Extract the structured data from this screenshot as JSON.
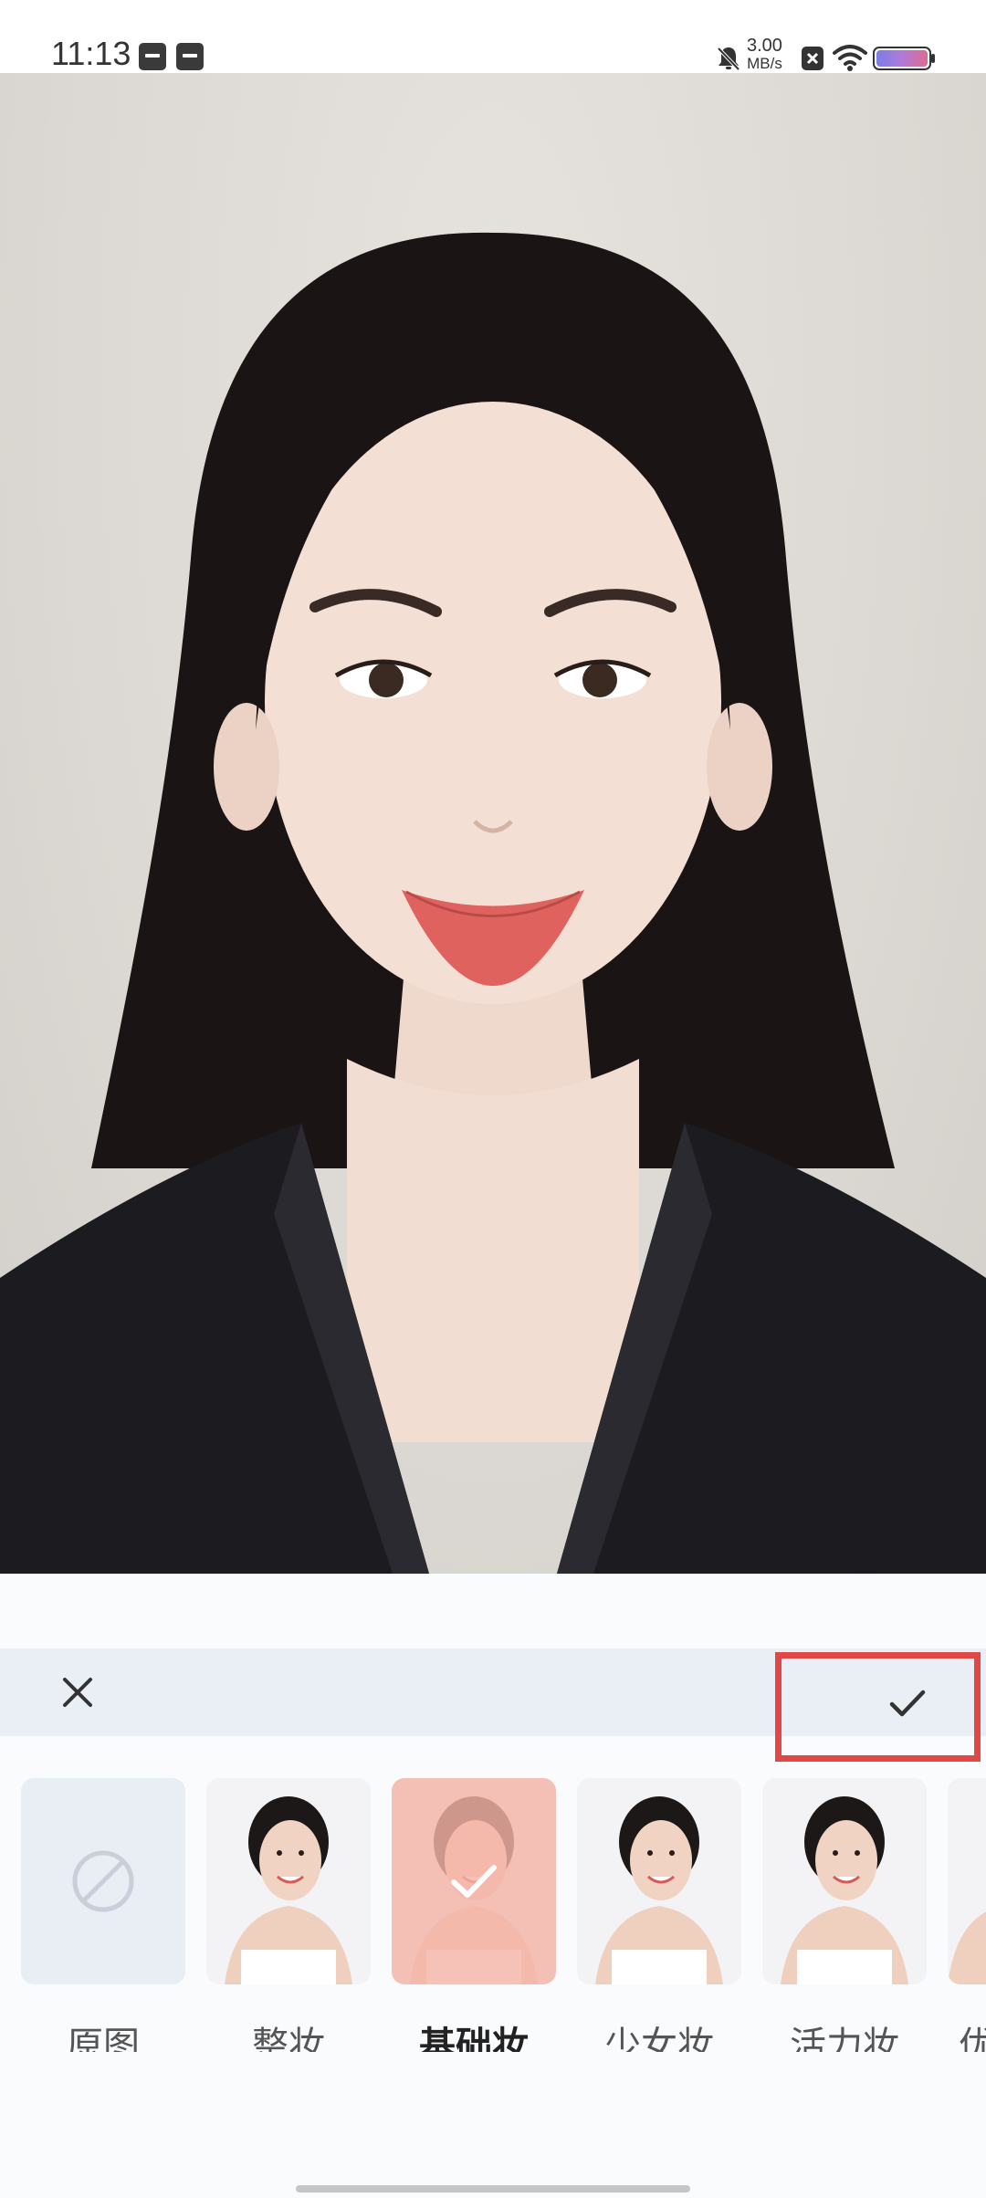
{
  "status_bar": {
    "time": "11:13",
    "net_speed_value": "3.00",
    "net_speed_unit": "MB/s",
    "icons": [
      "app-icon",
      "app-icon",
      "mute-bell-icon",
      "sim-x-icon",
      "wifi-icon",
      "battery-icon"
    ]
  },
  "photo": {
    "description_icon": "portrait-photo",
    "compare_button_icon": "compare-icon"
  },
  "action_bar": {
    "close_icon": "close-icon",
    "confirm_icon": "check-icon",
    "highlight_color": "#e04848"
  },
  "makeup_styles": [
    {
      "label": "原图",
      "selected": false,
      "thumb": "none-icon"
    },
    {
      "label": "整妆",
      "selected": false,
      "thumb": "model-photo"
    },
    {
      "label": "基础妆",
      "selected": true,
      "thumb": "model-photo"
    },
    {
      "label": "少女妆",
      "selected": false,
      "thumb": "model-photo"
    },
    {
      "label": "活力妆",
      "selected": false,
      "thumb": "model-photo"
    },
    {
      "label": "优",
      "selected": false,
      "thumb": "model-photo"
    }
  ],
  "colors": {
    "selected_overlay": "#f4b3a6",
    "panel_bg": "#fafbfd",
    "action_bar_bg": "#eaeef5"
  }
}
